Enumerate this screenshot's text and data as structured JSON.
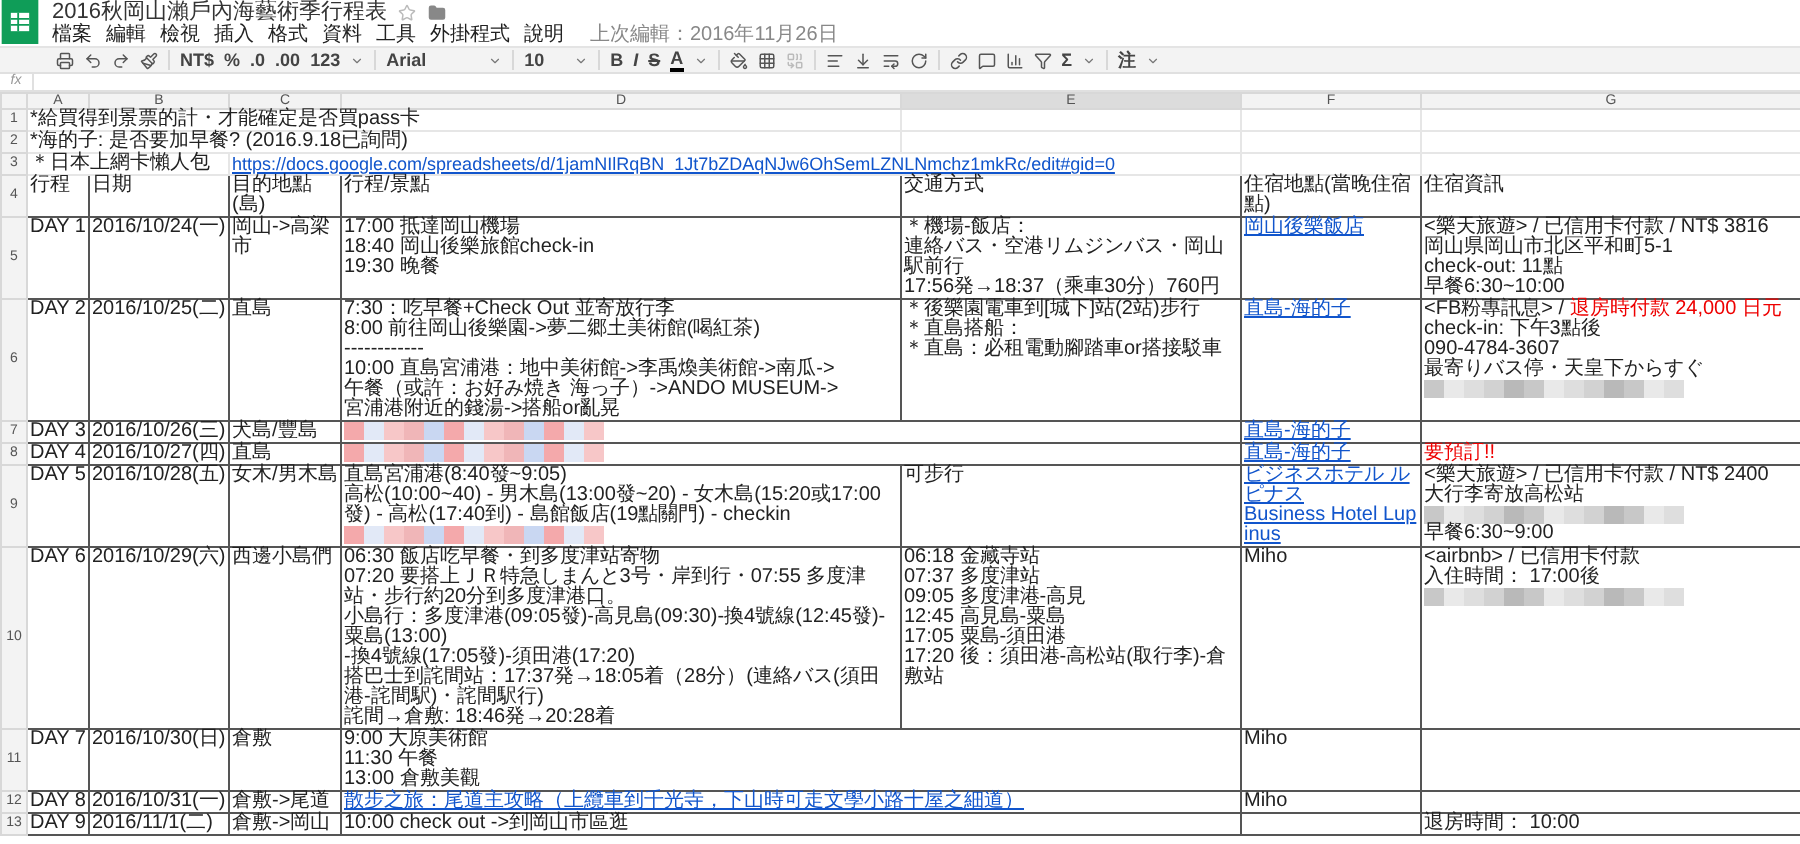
{
  "title": "2016秋岡山瀨戶內海藝術季行程表",
  "menu": [
    "檔案",
    "編輯",
    "檢視",
    "插入",
    "格式",
    "資料",
    "工具",
    "外掛程式",
    "說明"
  ],
  "last_edit": "上次編輯：2016年11月26日",
  "toolbar": {
    "currency": "NT$",
    "percent": "%",
    "decrease_decimals": ".0",
    "increase_decimals": ".00",
    "number_format": "123",
    "font": "Arial",
    "size": "10",
    "bold": "B",
    "italic": "I",
    "strike": "S",
    "text_color": "A",
    "sum": "Σ",
    "input_tools": "注"
  },
  "formula_label": "fx",
  "columns": [
    {
      "label": "A",
      "selected": false
    },
    {
      "label": "B",
      "selected": false
    },
    {
      "label": "C",
      "selected": false
    },
    {
      "label": "D",
      "selected": false
    },
    {
      "label": "E",
      "selected": true
    },
    {
      "label": "F",
      "selected": false
    },
    {
      "label": "G",
      "selected": false
    }
  ],
  "notes": [
    {
      "number": "1",
      "text": "*給買得到景票的計・才能確定是否買pass卡"
    },
    {
      "number": "2",
      "text": "*海的子: 是否要加早餐? (2016.9.18已詢問)"
    }
  ],
  "sim_guide": {
    "number": "3",
    "label": "＊日本上網卡懶人包",
    "link": "https://docs.google.com/spreadsheets/d/1jamNIlRqBN_1Jt7bZDAqNJw6OhSemLZNLNmchz1mkRc/edit#gid=0"
  },
  "header": {
    "number": "4",
    "labels": [
      "行程",
      "日期",
      "目的地點(島)",
      "行程/景點",
      "交通方式",
      "住宿地點(當晚住宿點)",
      "住宿資訊"
    ]
  },
  "days": [
    {
      "number": "5",
      "trip": "DAY 1",
      "date": "2016/10/24(一)",
      "destination": "岡山->高梁市",
      "itinerary": [
        "17:00 抵達岡山機場",
        "18:40 岡山後樂旅館check-in",
        "19:30 晚餐"
      ],
      "transport": [
        "＊機場-飯店：",
        "連絡バス・空港リムジンバス・岡山駅前行",
        "17:56発→18:37（乘車30分）760円"
      ],
      "lodging": [
        {
          "kind": "link",
          "text": "岡山後樂飯店"
        }
      ],
      "lodging_info": [
        "<樂天旅遊> / 已信用卡付款 / NT$ 3816",
        "岡山県岡山市北区平和町5-1",
        "check-out: 11點",
        "早餐6:30~10:00"
      ]
    },
    {
      "number": "6",
      "trip": "DAY 2",
      "date": "2016/10/25(二)",
      "destination": "直島",
      "itinerary": [
        "7:30：吃早餐+Check Out 並寄放行李",
        "8:00 前往岡山後樂園->夢二郷土美術館(喝紅茶)",
        "------------",
        "10:00 直島宮浦港：地中美術館->李禹煥美術館->南瓜->",
        "午餐（或許：お好み焼き 海っ子）->ANDO MUSEUM->",
        "宮浦港附近的錢湯->搭船or亂晃"
      ],
      "transport": [
        "＊後樂園電車到[城下]站(2站)步行",
        "＊直島搭船：",
        "＊直島：必租電動腳踏車or搭接駁車"
      ],
      "lodging": [
        {
          "kind": "link",
          "text": "直島-海的子"
        }
      ],
      "lodging_info": [
        {
          "kind": "mixed",
          "parts": [
            {
              "kind": "plain",
              "text": "<FB粉專訊息> / "
            },
            {
              "kind": "alert",
              "text": "退房時付款 24,000 日元"
            }
          ]
        },
        "check-in: 下午3點後",
        "090-4784-3607",
        "最寄りバス停・天皇下からすぐ",
        {
          "kind": "redacted"
        }
      ]
    },
    {
      "number": "7",
      "trip": "DAY 3",
      "date": "2016/10/26(三)",
      "destination": "犬島/豐島",
      "itinerary": [
        {
          "kind": "redacted"
        }
      ],
      "lodging": [
        {
          "kind": "link",
          "text": "直島-海的子"
        }
      ]
    },
    {
      "number": "8",
      "trip": "DAY 4",
      "date": "2016/10/27(四)",
      "destination": "直島",
      "itinerary": [
        {
          "kind": "redacted"
        }
      ],
      "lodging": [
        {
          "kind": "link",
          "text": "直島-海的子"
        }
      ],
      "lodging_info": [
        {
          "kind": "alert",
          "text": "要預訂!!"
        }
      ]
    },
    {
      "number": "9",
      "trip": "DAY 5",
      "date": "2016/10/28(五)",
      "destination": "女木/男木島",
      "itinerary": [
        "直島宮浦港(8:40發~9:05)",
        "高松(10:00~40) - 男木島(13:00發~20) - 女木島(15:20或17:00發) - 高松(17:40到) - 島館飯店(19點關門) - checkin",
        {
          "kind": "redacted"
        }
      ],
      "transport": [
        "可步行"
      ],
      "lodging": [
        {
          "kind": "link",
          "text": "ビジネスホテル ルピナス"
        },
        {
          "kind": "link",
          "text": "Business Hotel Lupinus"
        }
      ],
      "lodging_info": [
        "<樂天旅遊> / 已信用卡付款 / NT$ 2400",
        "大行李寄放高松站",
        {
          "kind": "redacted"
        },
        "早餐6:30~9:00"
      ]
    },
    {
      "number": "10",
      "trip": "DAY 6",
      "date": "2016/10/29(六)",
      "destination": "西邊小島們",
      "itinerary": [
        "06:30 飯店吃早餐・到多度津站寄物",
        "07:20 要搭上ＪＲ特急しまんと3号・岸到行・07:55 多度津站・步行約20分到多度津港口。",
        "小島行：多度津港(09:05發)-高見島(09:30)-換4號線(12:45發)-粟島(13:00)",
        "-換4號線(17:05發)-須田港(17:20)",
        "搭巴士到詫間站：17:37発→18:05着（28分）(連絡バス(須田港-詫間駅)・詫間駅行)",
        "詫間→倉敷: 18:46発→20:28着"
      ],
      "transport": [
        "06:18 金藏寺站",
        "07:37 多度津站",
        "09:05 多度津港-高見",
        "12:45 高見島-粟島",
        "17:05 粟島-須田港",
        "17:20 後：須田港-高松站(取行李)-倉敷站"
      ],
      "lodging": [
        "Miho"
      ],
      "lodging_info": [
        "<airbnb> / 已信用卡付款",
        "入住時間： 17:00後",
        {
          "kind": "redacted"
        }
      ]
    },
    {
      "number": "11",
      "trip": "DAY 7",
      "date": "2016/10/30(日)",
      "destination": "倉敷",
      "itinerary": [
        "9:00 大原美術館",
        "11:30 午餐",
        "13:00 倉敷美觀"
      ],
      "lodging": [
        "Miho"
      ]
    },
    {
      "number": "12",
      "trip": "DAY 8",
      "date": "2016/10/31(一)",
      "destination": "倉敷->尾道",
      "itinerary": [
        {
          "kind": "link",
          "text": "散步之旅：尾道主攻略（上纜車到千光寺，下山時可走文學小路十屋之細道）"
        }
      ],
      "lodging": [
        "Miho"
      ]
    },
    {
      "number": "13",
      "trip": "DAY 9",
      "date": "2016/11/1(二)",
      "destination": "倉敷->岡山",
      "itinerary": [
        "10:00 check out ->到岡山市區逛"
      ],
      "lodging_info": [
        "退房時間： 10:00"
      ]
    }
  ]
}
